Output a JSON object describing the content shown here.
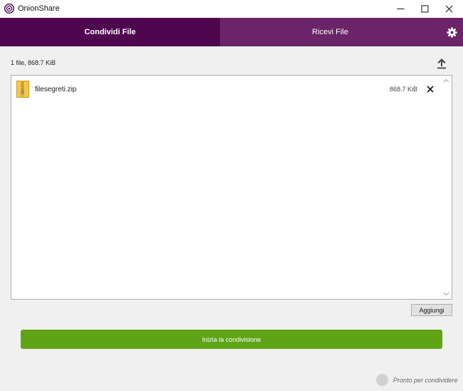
{
  "window": {
    "title": "OnionShare"
  },
  "tabs": {
    "share_label": "Condividi File",
    "receive_label": "Ricevi File"
  },
  "share": {
    "summary": "1 file, 868.7 KiB",
    "files": [
      {
        "name": "filesegreti.zip",
        "size": "868.7 KiB"
      }
    ],
    "add_label": "Aggiungi",
    "start_label": "Inizia la condivisione"
  },
  "status": {
    "text": "Pronto per condividere"
  },
  "colors": {
    "tab_active": "#4e064f",
    "tab_bar": "#692568",
    "start_button": "#5fa416"
  },
  "icons": {
    "app": "onionshare-logo-icon",
    "settings": "gear-icon",
    "upload": "upload-icon",
    "file": "zip-file-icon",
    "remove": "close-icon"
  }
}
